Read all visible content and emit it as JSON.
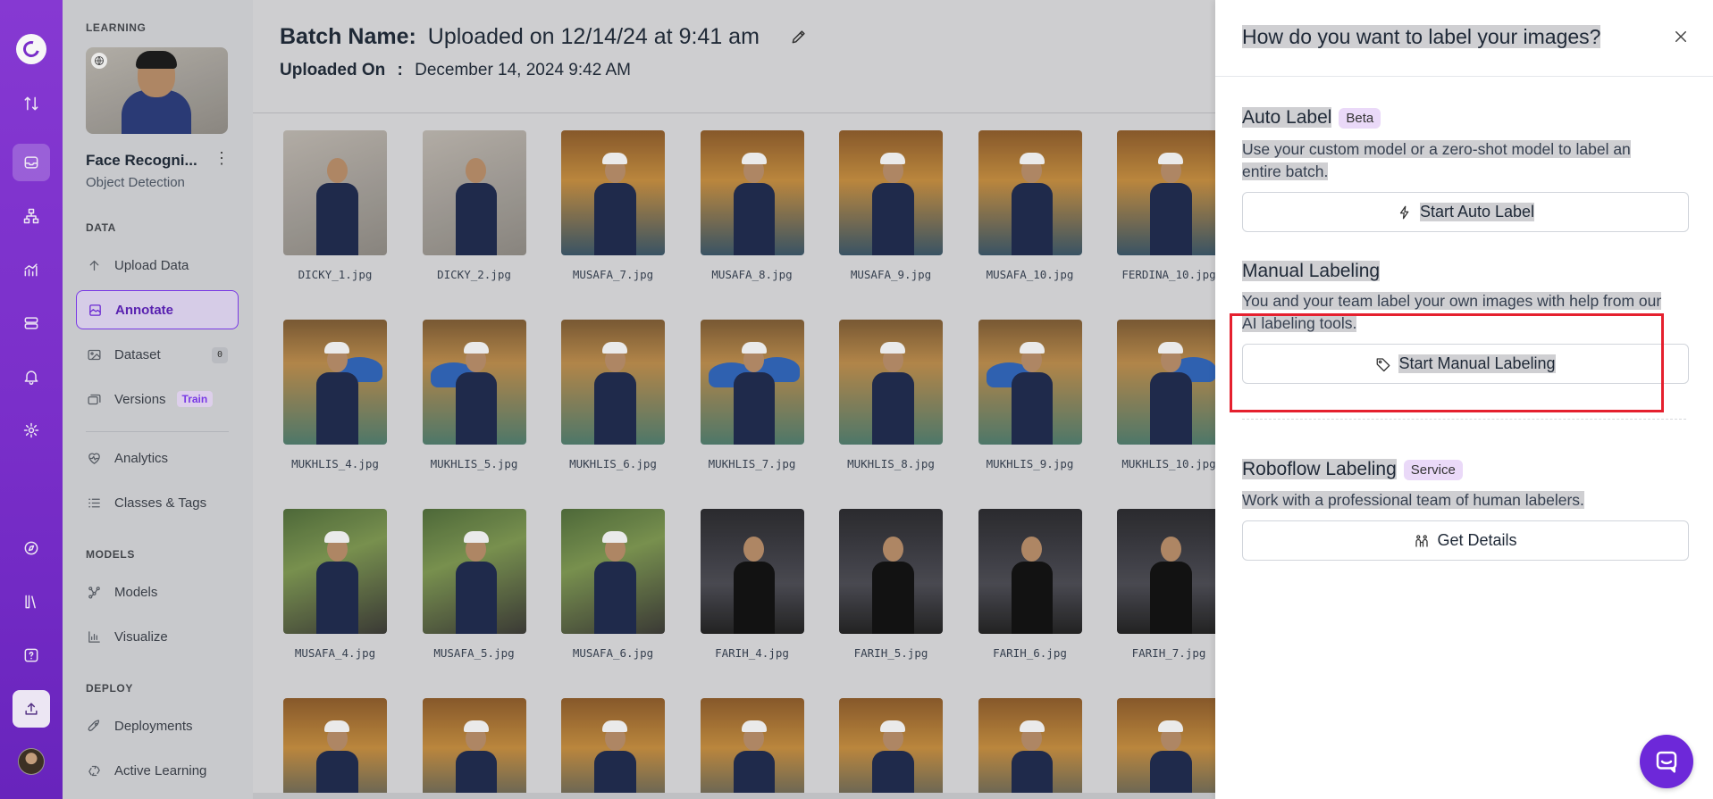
{
  "sidebar": {
    "section_learning": "LEARNING",
    "project_title": "Face Recogni...",
    "project_type": "Object Detection",
    "section_data": "DATA",
    "section_models": "MODELS",
    "section_deploy": "DEPLOY",
    "items": {
      "upload": {
        "label": "Upload Data",
        "icon": "arrow-up-icon"
      },
      "annotate": {
        "label": "Annotate",
        "icon": "annotate-icon"
      },
      "dataset": {
        "label": "Dataset",
        "count": "0",
        "icon": "image-icon"
      },
      "versions": {
        "label": "Versions",
        "badge": "Train",
        "icon": "stack-icon"
      },
      "analytics": {
        "label": "Analytics",
        "icon": "heart-pulse-icon"
      },
      "classes": {
        "label": "Classes & Tags",
        "icon": "list-icon"
      },
      "models": {
        "label": "Models",
        "icon": "nodes-icon"
      },
      "visualize": {
        "label": "Visualize",
        "icon": "chart-icon"
      },
      "deployments": {
        "label": "Deployments",
        "icon": "rocket-icon"
      },
      "active_learning": {
        "label": "Active Learning",
        "icon": "recycle-icon"
      }
    }
  },
  "main": {
    "batch_label": "Batch Name:",
    "batch_value": "Uploaded on 12/14/24 at 9:41 am",
    "uploaded_label": "Uploaded On",
    "uploaded_sep": ":",
    "uploaded_value": "December 14, 2024 9:42 AM",
    "images": [
      {
        "name": "DICKY_1.jpg"
      },
      {
        "name": "DICKY_2.jpg"
      },
      {
        "name": "MUSAFA_7.jpg"
      },
      {
        "name": "MUSAFA_8.jpg"
      },
      {
        "name": "MUSAFA_9.jpg"
      },
      {
        "name": "MUSAFA_10.jpg"
      },
      {
        "name": "FERDINA_10.jpg"
      },
      {
        "name": "MUKHLIS_4.jpg"
      },
      {
        "name": "MUKHLIS_5.jpg"
      },
      {
        "name": "MUKHLIS_6.jpg"
      },
      {
        "name": "MUKHLIS_7.jpg"
      },
      {
        "name": "MUKHLIS_8.jpg"
      },
      {
        "name": "MUKHLIS_9.jpg"
      },
      {
        "name": "MUKHLIS_10.jpg"
      },
      {
        "name": "MUSAFA_4.jpg"
      },
      {
        "name": "MUSAFA_5.jpg"
      },
      {
        "name": "MUSAFA_6.jpg"
      },
      {
        "name": "FARIH_4.jpg"
      },
      {
        "name": "FARIH_5.jpg"
      },
      {
        "name": "FARIH_6.jpg"
      },
      {
        "name": "FARIH_7.jpg"
      },
      {
        "name": ""
      },
      {
        "name": ""
      },
      {
        "name": ""
      },
      {
        "name": ""
      },
      {
        "name": ""
      },
      {
        "name": ""
      },
      {
        "name": ""
      }
    ]
  },
  "drawer": {
    "title": "How do you want to label your images?",
    "auto": {
      "title": "Auto Label",
      "tag": "Beta",
      "desc": "Use your custom model or a zero-shot model to label an entire batch.",
      "button": "Start Auto Label"
    },
    "manual": {
      "title": "Manual Labeling",
      "desc": "You and your team label your own images with help from our AI labeling tools.",
      "button": "Start Manual Labeling"
    },
    "roboflow": {
      "title": "Roboflow Labeling",
      "tag": "Service",
      "desc": "Work with a professional team of human labelers.",
      "button": "Get Details"
    }
  },
  "colors": {
    "brand": "#7c2ed0",
    "accent": "#6d28d9",
    "highlight_box": "#e5202e"
  }
}
